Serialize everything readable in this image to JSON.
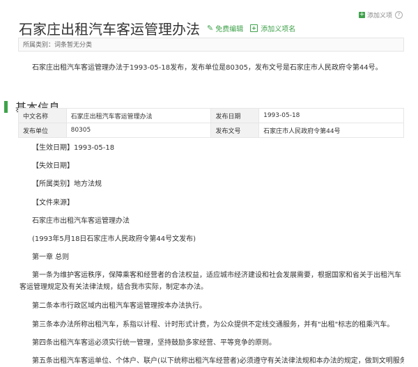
{
  "top_links": {
    "add_item": "添加义项",
    "help": "?"
  },
  "title": "石家庄出租汽车客运管理办法",
  "actions": {
    "edit": "免费编辑",
    "add_item": "添加义项名"
  },
  "category": "所属类别：词条暂无分类",
  "summary": "石家庄出租汽车客运管理办法于1993-05-18发布，发布单位是80305，发布文号是石家庄市人民政府令第44号。",
  "section_title": "基本信息",
  "info": {
    "rows": [
      {
        "l1": "中文名称",
        "v1": "石家庄出租汽车客运管理办法",
        "l2": "发布日期",
        "v2": "1993-05-18"
      },
      {
        "l1": "发布单位",
        "v1": "80305",
        "l2": "发布文号",
        "v2": "石家庄市人民政府令第44号"
      }
    ]
  },
  "content": {
    "effective_date": "【生效日期】1993-05-18",
    "expiry_date": "【失效日期】",
    "category": "【所属类别】地方法规",
    "source": "【文件来源】",
    "doc_title": "石家庄市出租汽车客运管理办法",
    "issued": "(1993年5月18日石家庄市人民政府令第44号文发布)",
    "chapter1": "第一章 总则",
    "art1": "第一条为维护客运秩序，保障乘客和经营者的合法权益，适应城市经济建设和社会发展需要，根据国家和省关于出租汽车客运管理规定及有关法律法规，结合我市实际，制定本办法。",
    "art2": "第二条本市行政区域内出租汽车客运管理按本办法执行。",
    "art3": "第三条本办法所称出租汽车，系指以计程、计时形式计费，为公众提供不定线交通服务，并有\"出租\"标志的租乘汽车。",
    "art4": "第四条出租汽车客运必须实行统一管理，坚持鼓励多家经营、平等竞争的原则。",
    "art5": "第五条出租汽车客运单位、个体户、联户(以下统称出租汽车经营者)必须遵守有关法律法规和本办法的规定，做到文明服务"
  }
}
